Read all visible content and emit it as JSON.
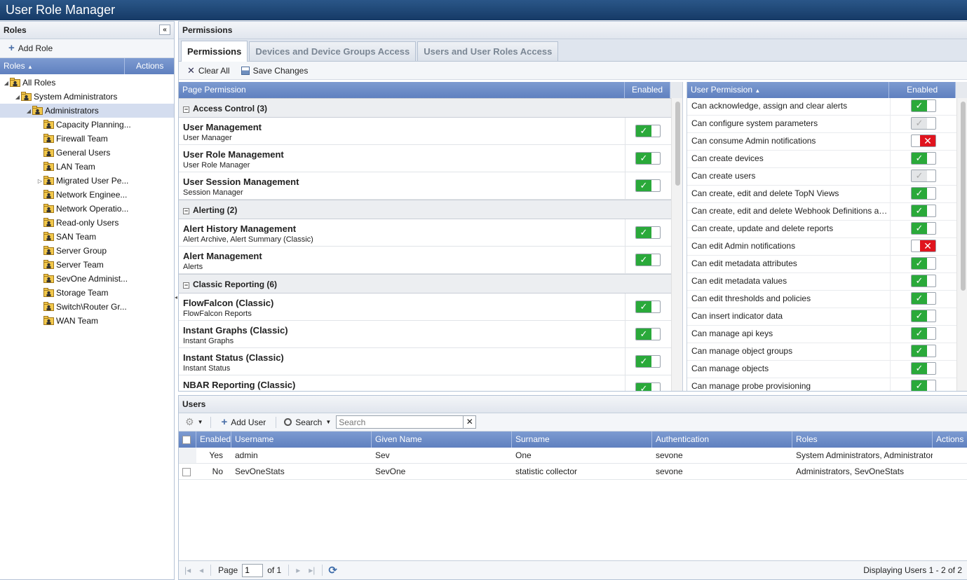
{
  "app": {
    "title": "User Role Manager"
  },
  "roles_panel": {
    "title": "Roles",
    "add_role": "Add Role",
    "col_roles": "Roles",
    "col_actions": "Actions",
    "tree": [
      {
        "label": "All Roles",
        "level": 0,
        "expander": "open",
        "selected": false
      },
      {
        "label": "System Administrators",
        "level": 1,
        "expander": "open",
        "selected": false
      },
      {
        "label": "Administrators",
        "level": 2,
        "expander": "open",
        "selected": true
      },
      {
        "label": "Capacity Planning...",
        "level": 3,
        "expander": "none",
        "selected": false
      },
      {
        "label": "Firewall Team",
        "level": 3,
        "expander": "none",
        "selected": false
      },
      {
        "label": "General Users",
        "level": 3,
        "expander": "none",
        "selected": false
      },
      {
        "label": "LAN Team",
        "level": 3,
        "expander": "none",
        "selected": false
      },
      {
        "label": "Migrated User Pe...",
        "level": 3,
        "expander": "closed",
        "selected": false
      },
      {
        "label": "Network Enginee...",
        "level": 3,
        "expander": "none",
        "selected": false
      },
      {
        "label": "Network Operatio...",
        "level": 3,
        "expander": "none",
        "selected": false
      },
      {
        "label": "Read-only Users",
        "level": 3,
        "expander": "none",
        "selected": false
      },
      {
        "label": "SAN Team",
        "level": 3,
        "expander": "none",
        "selected": false
      },
      {
        "label": "Server Group",
        "level": 3,
        "expander": "none",
        "selected": false
      },
      {
        "label": "Server Team",
        "level": 3,
        "expander": "none",
        "selected": false
      },
      {
        "label": "SevOne Administ...",
        "level": 3,
        "expander": "none",
        "selected": false
      },
      {
        "label": "Storage Team",
        "level": 3,
        "expander": "none",
        "selected": false
      },
      {
        "label": "Switch\\Router Gr...",
        "level": 3,
        "expander": "none",
        "selected": false
      },
      {
        "label": "WAN Team",
        "level": 3,
        "expander": "none",
        "selected": false
      }
    ]
  },
  "permissions_panel": {
    "title": "Permissions",
    "tabs": [
      {
        "label": "Permissions",
        "active": true
      },
      {
        "label": "Devices and Device Groups Access",
        "active": false
      },
      {
        "label": "Users and User Roles Access",
        "active": false
      }
    ],
    "clear_all": "Clear All",
    "save_changes": "Save Changes",
    "page_grid": {
      "col_page_permission": "Page Permission",
      "col_enabled": "Enabled",
      "rows": [
        {
          "type": "group",
          "label": "Access Control (3)"
        },
        {
          "type": "item",
          "title": "User Management",
          "sub": "User Manager",
          "state": "on"
        },
        {
          "type": "item",
          "title": "User Role Management",
          "sub": "User Role Manager",
          "state": "on"
        },
        {
          "type": "item",
          "title": "User Session Management",
          "sub": "Session Manager",
          "state": "on"
        },
        {
          "type": "group",
          "label": "Alerting (2)"
        },
        {
          "type": "item",
          "title": "Alert History Management",
          "sub": "Alert Archive, Alert Summary (Classic)",
          "state": "on"
        },
        {
          "type": "item",
          "title": "Alert Management",
          "sub": "Alerts",
          "state": "on"
        },
        {
          "type": "group",
          "label": "Classic Reporting (6)"
        },
        {
          "type": "item",
          "title": "FlowFalcon (Classic)",
          "sub": "FlowFalcon Reports",
          "state": "on"
        },
        {
          "type": "item",
          "title": "Instant Graphs (Classic)",
          "sub": "Instant Graphs",
          "state": "on"
        },
        {
          "type": "item",
          "title": "Instant Status (Classic)",
          "sub": "Instant Status",
          "state": "on"
        },
        {
          "type": "item",
          "title": "NBAR Reporting (Classic)",
          "sub": "",
          "state": "on"
        }
      ]
    },
    "user_grid": {
      "col_user_permission": "User Permission",
      "col_enabled": "Enabled",
      "rows": [
        {
          "label": "Can acknowledge, assign and clear alerts",
          "state": "on"
        },
        {
          "label": "Can configure system parameters",
          "state": "disabled"
        },
        {
          "label": "Can consume Admin notifications",
          "state": "off"
        },
        {
          "label": "Can create devices",
          "state": "on"
        },
        {
          "label": "Can create users",
          "state": "disabled"
        },
        {
          "label": "Can create, edit and delete TopN Views",
          "state": "on"
        },
        {
          "label": "Can create, edit and delete Webhook Definitions and T...",
          "state": "on"
        },
        {
          "label": "Can create, update and delete reports",
          "state": "on"
        },
        {
          "label": "Can edit Admin notifications",
          "state": "off"
        },
        {
          "label": "Can edit metadata attributes",
          "state": "on"
        },
        {
          "label": "Can edit metadata values",
          "state": "on"
        },
        {
          "label": "Can edit thresholds and policies",
          "state": "on"
        },
        {
          "label": "Can insert indicator data",
          "state": "on"
        },
        {
          "label": "Can manage api keys",
          "state": "on"
        },
        {
          "label": "Can manage object groups",
          "state": "on"
        },
        {
          "label": "Can manage objects",
          "state": "on"
        },
        {
          "label": "Can manage probe provisioning",
          "state": "on"
        }
      ]
    }
  },
  "users_panel": {
    "title": "Users",
    "add_user": "Add User",
    "search_label": "Search",
    "search_placeholder": "Search",
    "columns": [
      "Enabled",
      "Username",
      "Given Name",
      "Surname",
      "Authentication",
      "Roles",
      "Actions"
    ],
    "rows": [
      {
        "enabled": "Yes",
        "username": "admin",
        "given": "Sev",
        "surname": "One",
        "auth": "sevone",
        "roles": "System Administrators, Administrators",
        "checkbox": false
      },
      {
        "enabled": "No",
        "username": "SevOneStats",
        "given": "SevOne",
        "surname": "statistic collector",
        "auth": "sevone",
        "roles": "Administrators, SevOneStats",
        "checkbox": true
      }
    ],
    "pager": {
      "page_label": "Page",
      "page_value": "1",
      "of_label": "of 1",
      "display_text": "Displaying Users 1 - 2 of 2"
    }
  },
  "colors": {
    "header_blue": "#6c8cc9",
    "toggle_on": "#2aa93a",
    "toggle_off": "#e0141e"
  }
}
